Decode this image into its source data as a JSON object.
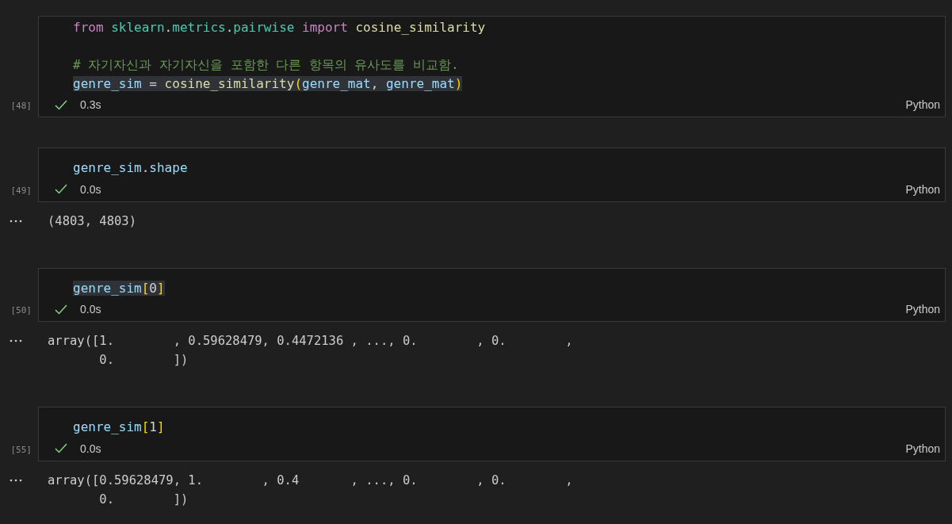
{
  "cells": [
    {
      "execution_count": "[48]",
      "succeeded": true,
      "duration": "0.3s",
      "language": "Python",
      "lines": [
        {
          "kind": "code",
          "highlighted": false,
          "tokens": [
            {
              "text": "from ",
              "kind": "keyword"
            },
            {
              "text": "sklearn",
              "kind": "module"
            },
            {
              "text": ".",
              "kind": "plain"
            },
            {
              "text": "metrics",
              "kind": "module"
            },
            {
              "text": ".",
              "kind": "plain"
            },
            {
              "text": "pairwise ",
              "kind": "module"
            },
            {
              "text": "import ",
              "kind": "keyword"
            },
            {
              "text": "cosine_similarity",
              "kind": "function"
            }
          ]
        },
        {
          "kind": "blank"
        },
        {
          "kind": "code",
          "highlighted": false,
          "tokens": [
            {
              "text": "# 자기자신과 자기자신을 포함한 다른 항목의 유사도를 비교함.",
              "kind": "comment"
            }
          ]
        },
        {
          "kind": "code",
          "highlighted": true,
          "tokens": [
            {
              "text": "genre_sim",
              "kind": "variable"
            },
            {
              "text": " = ",
              "kind": "plain"
            },
            {
              "text": "cosine_similarity",
              "kind": "function"
            },
            {
              "text": "(",
              "kind": "bracket"
            },
            {
              "text": "genre_mat",
              "kind": "variable"
            },
            {
              "text": ", ",
              "kind": "plain"
            },
            {
              "text": "genre_mat",
              "kind": "variable"
            },
            {
              "text": ")",
              "kind": "bracket"
            }
          ]
        }
      ]
    },
    {
      "execution_count": "[49]",
      "succeeded": true,
      "duration": "0.0s",
      "language": "Python",
      "lines": [
        {
          "kind": "code",
          "highlighted": false,
          "tokens": [
            {
              "text": "genre_sim",
              "kind": "variable"
            },
            {
              "text": ".",
              "kind": "plain"
            },
            {
              "text": "shape",
              "kind": "variable"
            }
          ]
        }
      ],
      "output": [
        "(4803, 4803)"
      ]
    },
    {
      "execution_count": "[50]",
      "succeeded": true,
      "duration": "0.0s",
      "language": "Python",
      "lines": [
        {
          "kind": "code",
          "highlighted": true,
          "tokens": [
            {
              "text": "genre_sim",
              "kind": "variable"
            },
            {
              "text": "[",
              "kind": "bracket"
            },
            {
              "text": "0",
              "kind": "plain"
            },
            {
              "text": "]",
              "kind": "bracket"
            }
          ]
        }
      ],
      "output": [
        "array([1.        , 0.59628479, 0.4472136 , ..., 0.        , 0.        ,",
        "       0.        ])"
      ]
    },
    {
      "execution_count": "[55]",
      "succeeded": true,
      "duration": "0.0s",
      "language": "Python",
      "lines": [
        {
          "kind": "code",
          "highlighted": false,
          "tokens": [
            {
              "text": "genre_sim",
              "kind": "variable"
            },
            {
              "text": "[",
              "kind": "bracket"
            },
            {
              "text": "1",
              "kind": "plain"
            },
            {
              "text": "]",
              "kind": "bracket"
            }
          ]
        }
      ],
      "output": [
        "array([0.59628479, 1.        , 0.4       , ..., 0.        , 0.        ,",
        "       0.        ])"
      ]
    }
  ]
}
